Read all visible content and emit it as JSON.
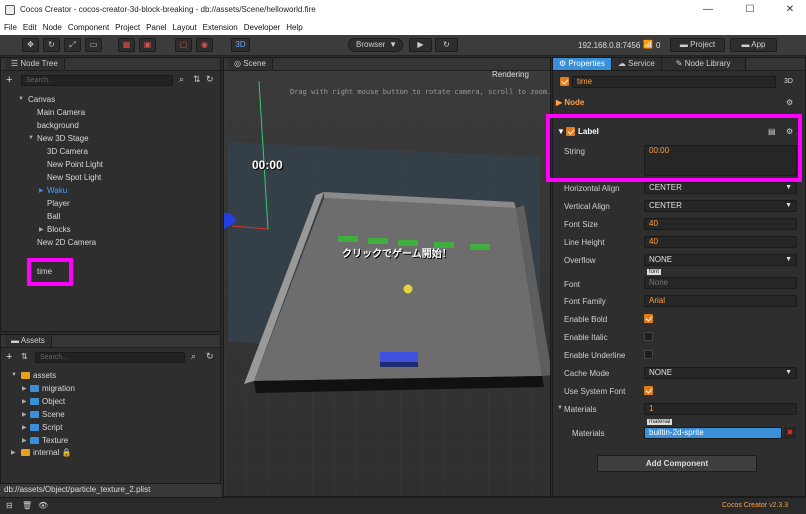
{
  "window": {
    "title": "Cocos Creator - cocos-creator-3d-block-breaking - db://assets/Scene/helloworld.fire",
    "min": "—",
    "max": "☐",
    "close": "✕"
  },
  "menu": [
    "File",
    "Edit",
    "Node",
    "Component",
    "Project",
    "Panel",
    "Layout",
    "Extension",
    "Developer",
    "Help"
  ],
  "toolbar": {
    "mode_3d": "3D",
    "platform": "Browser",
    "ip": "192.168.0.8:7456",
    "wifi_count": "0",
    "project_btn": "Project",
    "app_btn": "App"
  },
  "node_tree": {
    "tab": "Node Tree",
    "search_placeholder": "Search...",
    "items": [
      "Canvas",
      "Main Camera",
      "background",
      "New 3D Stage",
      "3D Camera",
      "New Point Light",
      "New Spot Light",
      "Waku",
      "Player",
      "Ball",
      "Blocks",
      "New 2D Camera",
      "time"
    ]
  },
  "assets": {
    "tab": "Assets",
    "search_placeholder": "Search...",
    "items": [
      "assets",
      "migration",
      "Object",
      "Scene",
      "Script",
      "Texture",
      "internal"
    ],
    "status_path": "db://assets/Object/particle_texture_2.plist"
  },
  "scene": {
    "tab": "Scene",
    "rendering": "Rendering",
    "hint": "Drag with right mouse button to rotate camera, scroll to zoom...",
    "timer_text": "00:00",
    "start_text": "クリックでゲーム開始！"
  },
  "properties": {
    "tabs": [
      "Properties",
      "Service",
      "Node Library"
    ],
    "node_name": "time",
    "badge_3d": "3D",
    "section_node": "Node",
    "section_label": "Label",
    "string_label": "String",
    "string_value": "00:00",
    "rows": {
      "h_align": "Horizontal Align",
      "h_align_val": "CENTER",
      "v_align": "Vertical Align",
      "v_align_val": "CENTER",
      "font_size": "Font Size",
      "font_size_val": "40",
      "line_height": "Line Height",
      "line_height_val": "40",
      "overflow": "Overflow",
      "overflow_val": "NONE",
      "font": "Font",
      "font_tag": "font",
      "font_val": "None",
      "font_family": "Font Family",
      "font_family_val": "Arial",
      "bold": "Enable Bold",
      "italic": "Enable Italic",
      "underline": "Enable Underline",
      "cache_mode": "Cache Mode",
      "cache_mode_val": "NONE",
      "system_font": "Use System Font",
      "materials_count_label": "Materials",
      "materials_count": "1",
      "materials": "Materials",
      "material_tag": "material",
      "material_val": "builtin-2d-sprite"
    },
    "add_component": "Add Component",
    "version": "Cocos Creator v2.3.3",
    "checks": {
      "bold": true,
      "italic": false,
      "underline": false,
      "system_font": true
    }
  },
  "colors": {
    "accent": "#3a8fd8",
    "highlight": "#ff00ff",
    "orange": "#ff9e3d"
  }
}
